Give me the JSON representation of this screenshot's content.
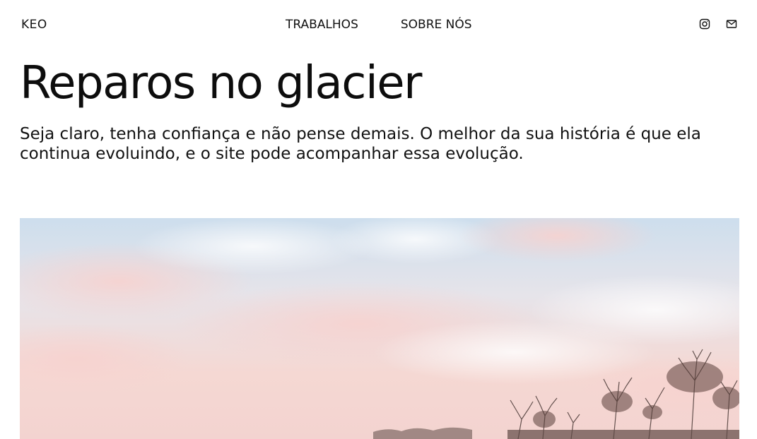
{
  "header": {
    "brand": "KEO",
    "nav": [
      {
        "label": "TRABALHOS"
      },
      {
        "label": "SOBRE NÓS"
      }
    ],
    "social": [
      {
        "icon": "instagram-icon"
      },
      {
        "icon": "mail-icon"
      }
    ]
  },
  "hero": {
    "title": "Reparos no glacier",
    "subtitle": "Seja claro, tenha confiança e não pense demais. O melhor da sua história é que ela continua evoluindo, e o site pode acompanhar essa evolução.",
    "image": {
      "subject": "sunset-sky-with-bare-trees",
      "sky_top_color": "#cfdfee",
      "sky_horizon_color": "#f6d6d2"
    }
  }
}
